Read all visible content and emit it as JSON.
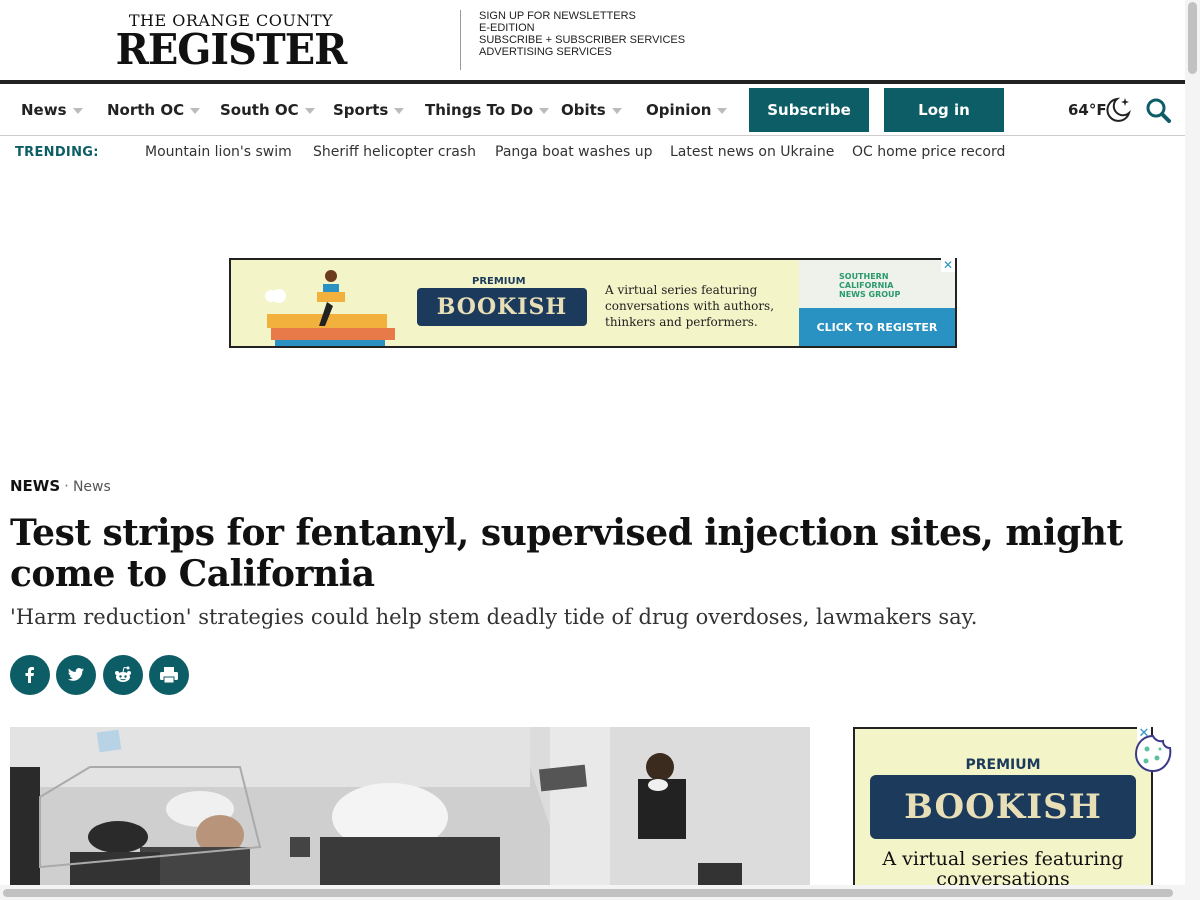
{
  "masthead": {
    "logo_top": "THE ORANGE COUNTY",
    "logo_main": "REGISTER",
    "links": [
      "SIGN UP FOR NEWSLETTERS",
      "E-EDITION",
      "SUBSCRIBE + SUBSCRIBER SERVICES",
      "ADVERTISING SERVICES"
    ]
  },
  "nav": {
    "items": [
      "News",
      "North OC",
      "South OC",
      "Sports",
      "Things To Do",
      "Obits",
      "Opinion"
    ],
    "subscribe": "Subscribe",
    "login": "Log in",
    "temperature": "64°F",
    "weather_icon": "moon-stars-icon",
    "search_icon": "search-icon"
  },
  "trending": {
    "label": "TRENDING:",
    "links": [
      "Mountain lion's swim",
      "Sheriff helicopter crash",
      "Panga boat washes up",
      "Latest news on Ukraine",
      "OC home price record"
    ]
  },
  "banner_ad": {
    "premium": "PREMIUM",
    "title": "BOOKISH",
    "text": "A virtual series featuring conversations with authors, thinkers and performers.",
    "sponsor": "SOUTHERN CALIFORNIA NEWS GROUP",
    "cta": "CLICK TO REGISTER",
    "close": "✕"
  },
  "article": {
    "section": "NEWS",
    "subsection": "News",
    "headline": "Test strips for fentanyl, supervised injection sites, might come to California",
    "dek": "'Harm reduction' strategies could help stem deadly tide of drug overdoses, lawmakers say.",
    "share_buttons": [
      "facebook-icon",
      "twitter-icon",
      "reddit-icon",
      "print-icon"
    ]
  },
  "side_ad": {
    "premium": "PREMIUM",
    "title": "BOOKISH",
    "text": "A virtual series featuring conversations",
    "close": "✕"
  },
  "colors": {
    "brand_teal": "#0d5d67",
    "ad_blue": "#2a92c2",
    "ad_navy": "#1c3b5c",
    "ad_cream": "#f3f4c8"
  }
}
